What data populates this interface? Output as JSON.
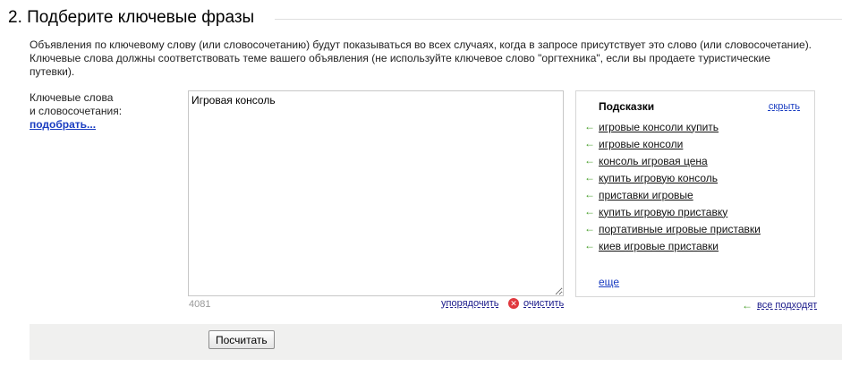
{
  "section": {
    "title": "2. Подберите ключевые фразы",
    "description": "Объявления по ключевому слову (или словосочетанию) будут показываться во всех случаях, когда в запросе присутствует это слово (или словосочетание). Ключевые слова должны соответствовать теме вашего объявления (не используйте ключевое слово \"оргтехника\", если вы продаете туристические путевки)."
  },
  "keywords": {
    "label_line1": "Ключевые слова",
    "label_line2": "и словосочетания:",
    "pick_link": "подобрать...",
    "textarea_value": "Игровая консоль",
    "counter": "4081",
    "sort_link": "упорядочить",
    "clear_link": "очистить"
  },
  "hints": {
    "title": "Подсказки",
    "hide_link": "скрыть",
    "items": [
      "игровые консоли купить",
      "игровые консоли",
      "консоль игровая цена",
      "купить игровую консоль",
      "приставки игровые",
      "купить игровую приставку",
      "портативные игровые приставки",
      "киев игровые приставки"
    ],
    "more_link": "еще",
    "all_fit_link": "все подходят"
  },
  "actions": {
    "calc_button": "Посчитать"
  },
  "icons": {
    "hint_arrow": "arrow-left-icon",
    "clear": "clear-icon"
  },
  "colors": {
    "link_blue": "#1a3dc1",
    "arrow_green": "#4aa02c",
    "clear_red": "#e0383e",
    "bottom_bar": "#f0f0ef"
  }
}
